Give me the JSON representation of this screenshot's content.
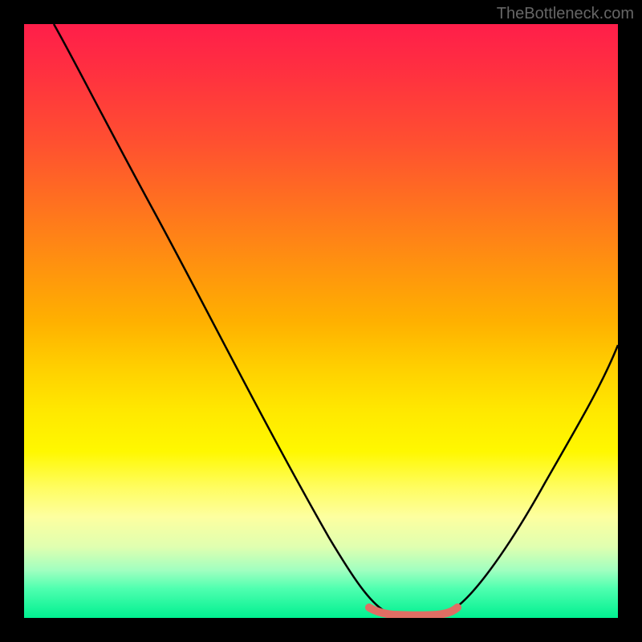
{
  "watermark": "TheBottleneck.com",
  "chart_data": {
    "type": "line",
    "title": "",
    "xlabel": "",
    "ylabel": "",
    "xlim": [
      0,
      100
    ],
    "ylim": [
      0,
      100
    ],
    "description": "Bottleneck curve showing a V-shaped profile descending from top-left to a minimum trough around x=60-70, then rising toward the right edge. Background is a vertical gradient from red (high bottleneck) through orange/yellow to green (low bottleneck) at the bottom.",
    "series": [
      {
        "name": "bottleneck-curve",
        "color": "#000000",
        "x": [
          5,
          10,
          15,
          20,
          25,
          30,
          35,
          40,
          45,
          50,
          55,
          58,
          60,
          62,
          64,
          66,
          68,
          70,
          72,
          75,
          80,
          85,
          90,
          95,
          100
        ],
        "y": [
          100,
          92,
          83,
          74,
          65,
          55,
          46,
          36,
          27,
          18,
          9,
          4,
          2,
          1,
          0.5,
          0.5,
          0.5,
          1,
          2,
          5,
          13,
          22,
          32,
          43,
          54
        ]
      },
      {
        "name": "trough-highlight",
        "color": "#e0746a",
        "x": [
          58,
          60,
          62,
          64,
          66,
          68,
          70,
          72
        ],
        "y": [
          2,
          1,
          0.5,
          0.5,
          0.5,
          0.5,
          1,
          2
        ]
      }
    ],
    "gradient_stops": [
      {
        "pct": 0,
        "color": "#ff1e4a"
      },
      {
        "pct": 50,
        "color": "#ffd000"
      },
      {
        "pct": 78,
        "color": "#fffd60"
      },
      {
        "pct": 100,
        "color": "#00f090"
      }
    ]
  }
}
